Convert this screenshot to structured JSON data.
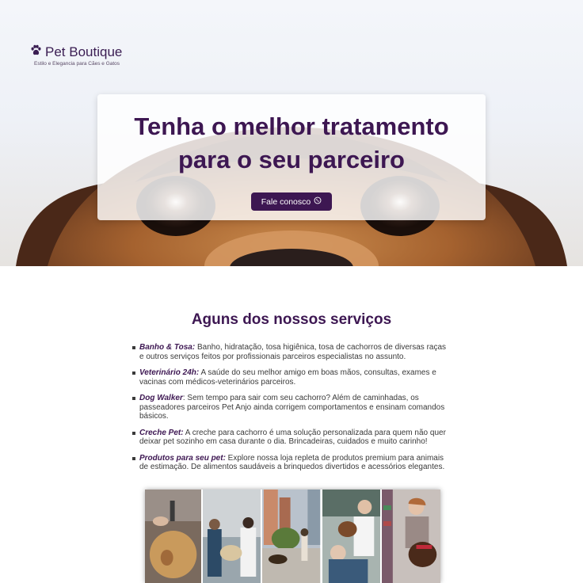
{
  "brand": {
    "name": "Pet Boutique",
    "tagline": "Estilo e Elegancia para Cães e Gatos",
    "icon": "paw-icon"
  },
  "hero": {
    "title_line1": "Tenha o melhor tratamento",
    "title_line2": "para o seu parceiro",
    "cta_label": "Fale conosco",
    "cta_icon": "whatsapp-icon"
  },
  "services": {
    "title": "Aguns dos nossos serviços",
    "items": [
      {
        "name": "Banho & Tosa:",
        "text": " Banho, hidratação, tosa higiênica, tosa de cachorros de diversas raças e outros serviços feitos por profissionais parceiros especialistas no assunto."
      },
      {
        "name": "Veterinário 24h:",
        "text": " A saúde do seu melhor amigo em boas mãos, consultas, exames e vacinas com médicos-veterinários parceiros."
      },
      {
        "name": "Dog Walker",
        "text": ": Sem tempo para sair com seu cachorro? Além de caminhadas, os passeadores parceiros Pet Anjo ainda corrigem comportamentos e ensinam comandos básicos."
      },
      {
        "name": "Creche Pet:",
        "text": " A creche para cachorro é uma solução personalizada para quem não quer deixar pet sozinho em casa durante o dia. Brincadeiras, cuidados e muito carinho!"
      },
      {
        "name": "Produtos para seu pet:",
        "text": " Explore nossa loja repleta de produtos premium para animais de estimação. De alimentos saudáveis a brinquedos divertidos e acessórios elegantes."
      }
    ]
  },
  "colors": {
    "primary": "#3d1752",
    "text": "#3a3a3a"
  }
}
